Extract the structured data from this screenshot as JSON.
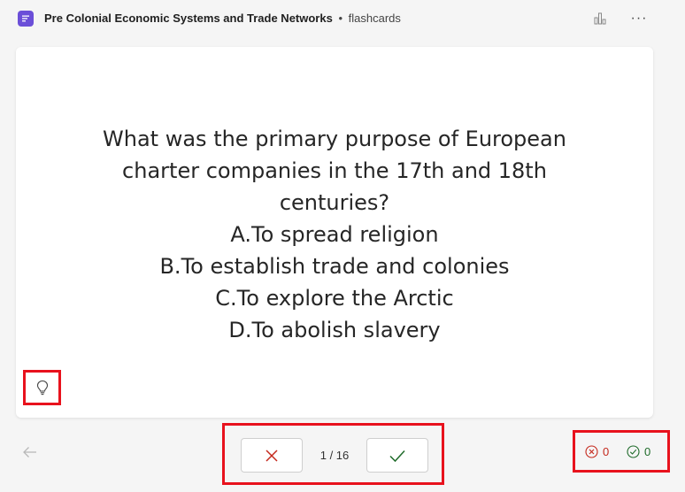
{
  "header": {
    "deck_title": "Pre Colonial Economic Systems and Trade Networks",
    "separator": "•",
    "kind": "flashcards",
    "more_label": "···"
  },
  "card": {
    "question_lines": [
      "What was the primary purpose of European",
      "charter companies in the 17th and 18th",
      "centuries?",
      "A.To spread religion",
      "B.To establish trade and colonies",
      "C.To explore the Arctic",
      "D.To abolish slavery"
    ]
  },
  "controls": {
    "counter": "1 / 16"
  },
  "score": {
    "wrong": "0",
    "right": "0"
  },
  "colors": {
    "accent": "#6b4fd8",
    "wrong": "#c4281c",
    "right": "#1f6b2a",
    "highlight": "#e8121d"
  },
  "icons": [
    "app-icon",
    "stats-icon",
    "more-icon",
    "lightbulb-icon",
    "arrow-left-icon",
    "close-icon",
    "checkmark-icon",
    "wrong-circle-icon",
    "right-circle-icon"
  ]
}
